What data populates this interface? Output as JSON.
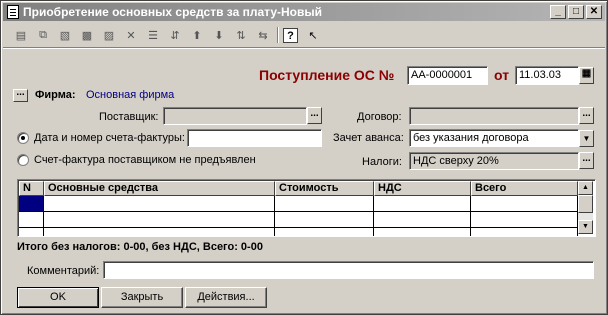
{
  "window": {
    "title": "Приобретение основных средств за плату-Новый",
    "buttons": [
      "_",
      "□",
      "✕"
    ]
  },
  "toolbar": {
    "icons": [
      "new-document-icon",
      "copy-icon",
      "delete-mark-icon",
      "folder-copy-icon",
      "folder-icon",
      "delete-icon",
      "filter-icon",
      "move-icon",
      "arrow-up-icon",
      "arrow-down-icon",
      "sort-asc-icon",
      "sort-desc-icon",
      "help-icon",
      "whats-this-icon"
    ]
  },
  "header": {
    "doc_title": "Поступление ОС №",
    "doc_number": "АА-0000001",
    "date_label": "от",
    "date": "11.03.03"
  },
  "firm": {
    "label": "Фирма:",
    "value": "Основная фирма"
  },
  "supplier": {
    "label": "Поставщик:",
    "value": ""
  },
  "contract": {
    "label": "Договор:",
    "value": ""
  },
  "invoice": {
    "label": "Дата и номер счета-фактуры:",
    "value": ""
  },
  "advance": {
    "label": "Зачет аванса:",
    "value": "без указания договора"
  },
  "invoice_missing": {
    "label": "Счет-фактура поставщиком не предъявлен"
  },
  "taxes": {
    "label": "Налоги:",
    "value": "НДС сверху 20%"
  },
  "table": {
    "columns": [
      "N",
      "Основные средства",
      "Стоимость",
      "НДС",
      "Всего"
    ],
    "rows": []
  },
  "totals": {
    "text": "Итого без налогов: 0-00, без НДС, Всего: 0-00"
  },
  "comment": {
    "label": "Комментарий:",
    "value": ""
  },
  "buttons": {
    "ok": "OK",
    "close": "Закрыть",
    "actions": "Действия..."
  },
  "colors": {
    "title_accent": "#8b0000",
    "firm_value": "#000080",
    "selected_row": "#000080"
  }
}
